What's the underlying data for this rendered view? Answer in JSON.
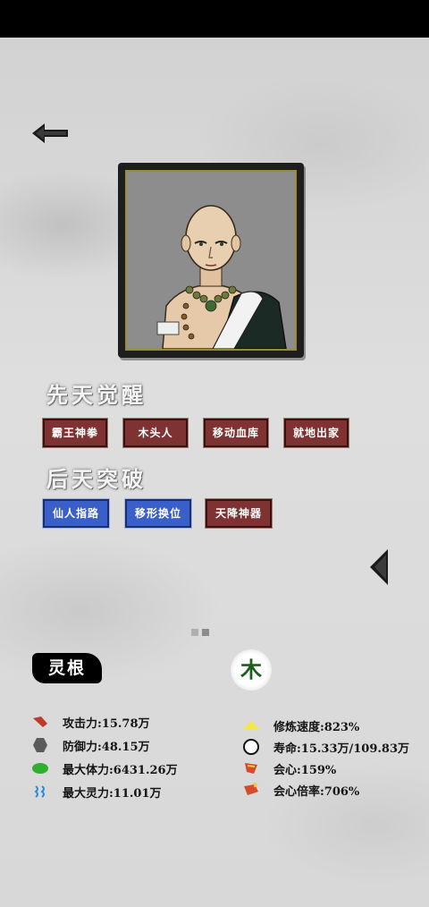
{
  "nav": {
    "back_icon": "back-arrow-icon",
    "next_icon": "chevron-left-icon"
  },
  "innate": {
    "title": "先天觉醒",
    "tags": [
      "霸王神拳",
      "木头人",
      "移动血库",
      "就地出家"
    ]
  },
  "acquired": {
    "title": "后天突破",
    "tags": [
      {
        "label": "仙人指路",
        "color": "blue"
      },
      {
        "label": "移形换位",
        "color": "blue"
      },
      {
        "label": "天降神器",
        "color": "red"
      }
    ]
  },
  "pager": {
    "count": 2,
    "active": 2
  },
  "spirit_root": {
    "label": "灵根",
    "element": "木"
  },
  "stats_left": [
    {
      "icon": "attack-icon",
      "text": "攻击力:15.78万"
    },
    {
      "icon": "defense-icon",
      "text": "防御力:48.15万"
    },
    {
      "icon": "hp-icon",
      "text": "最大体力:6431.26万"
    },
    {
      "icon": "spirit-icon",
      "text": "最大灵力:11.01万"
    }
  ],
  "stats_right": [
    {
      "icon": "cultivation-speed-icon",
      "text": "修炼速度:823%"
    },
    {
      "icon": "lifespan-icon",
      "text": "寿命:15.33万/109.83万"
    },
    {
      "icon": "crit-icon",
      "text": "会心:159%"
    },
    {
      "icon": "crit-multiplier-icon",
      "text": "会心倍率:706%"
    }
  ],
  "colors": {
    "tag_red": "#7e3232",
    "tag_blue": "#3b5fc8",
    "element_green": "#1c5f1c"
  }
}
